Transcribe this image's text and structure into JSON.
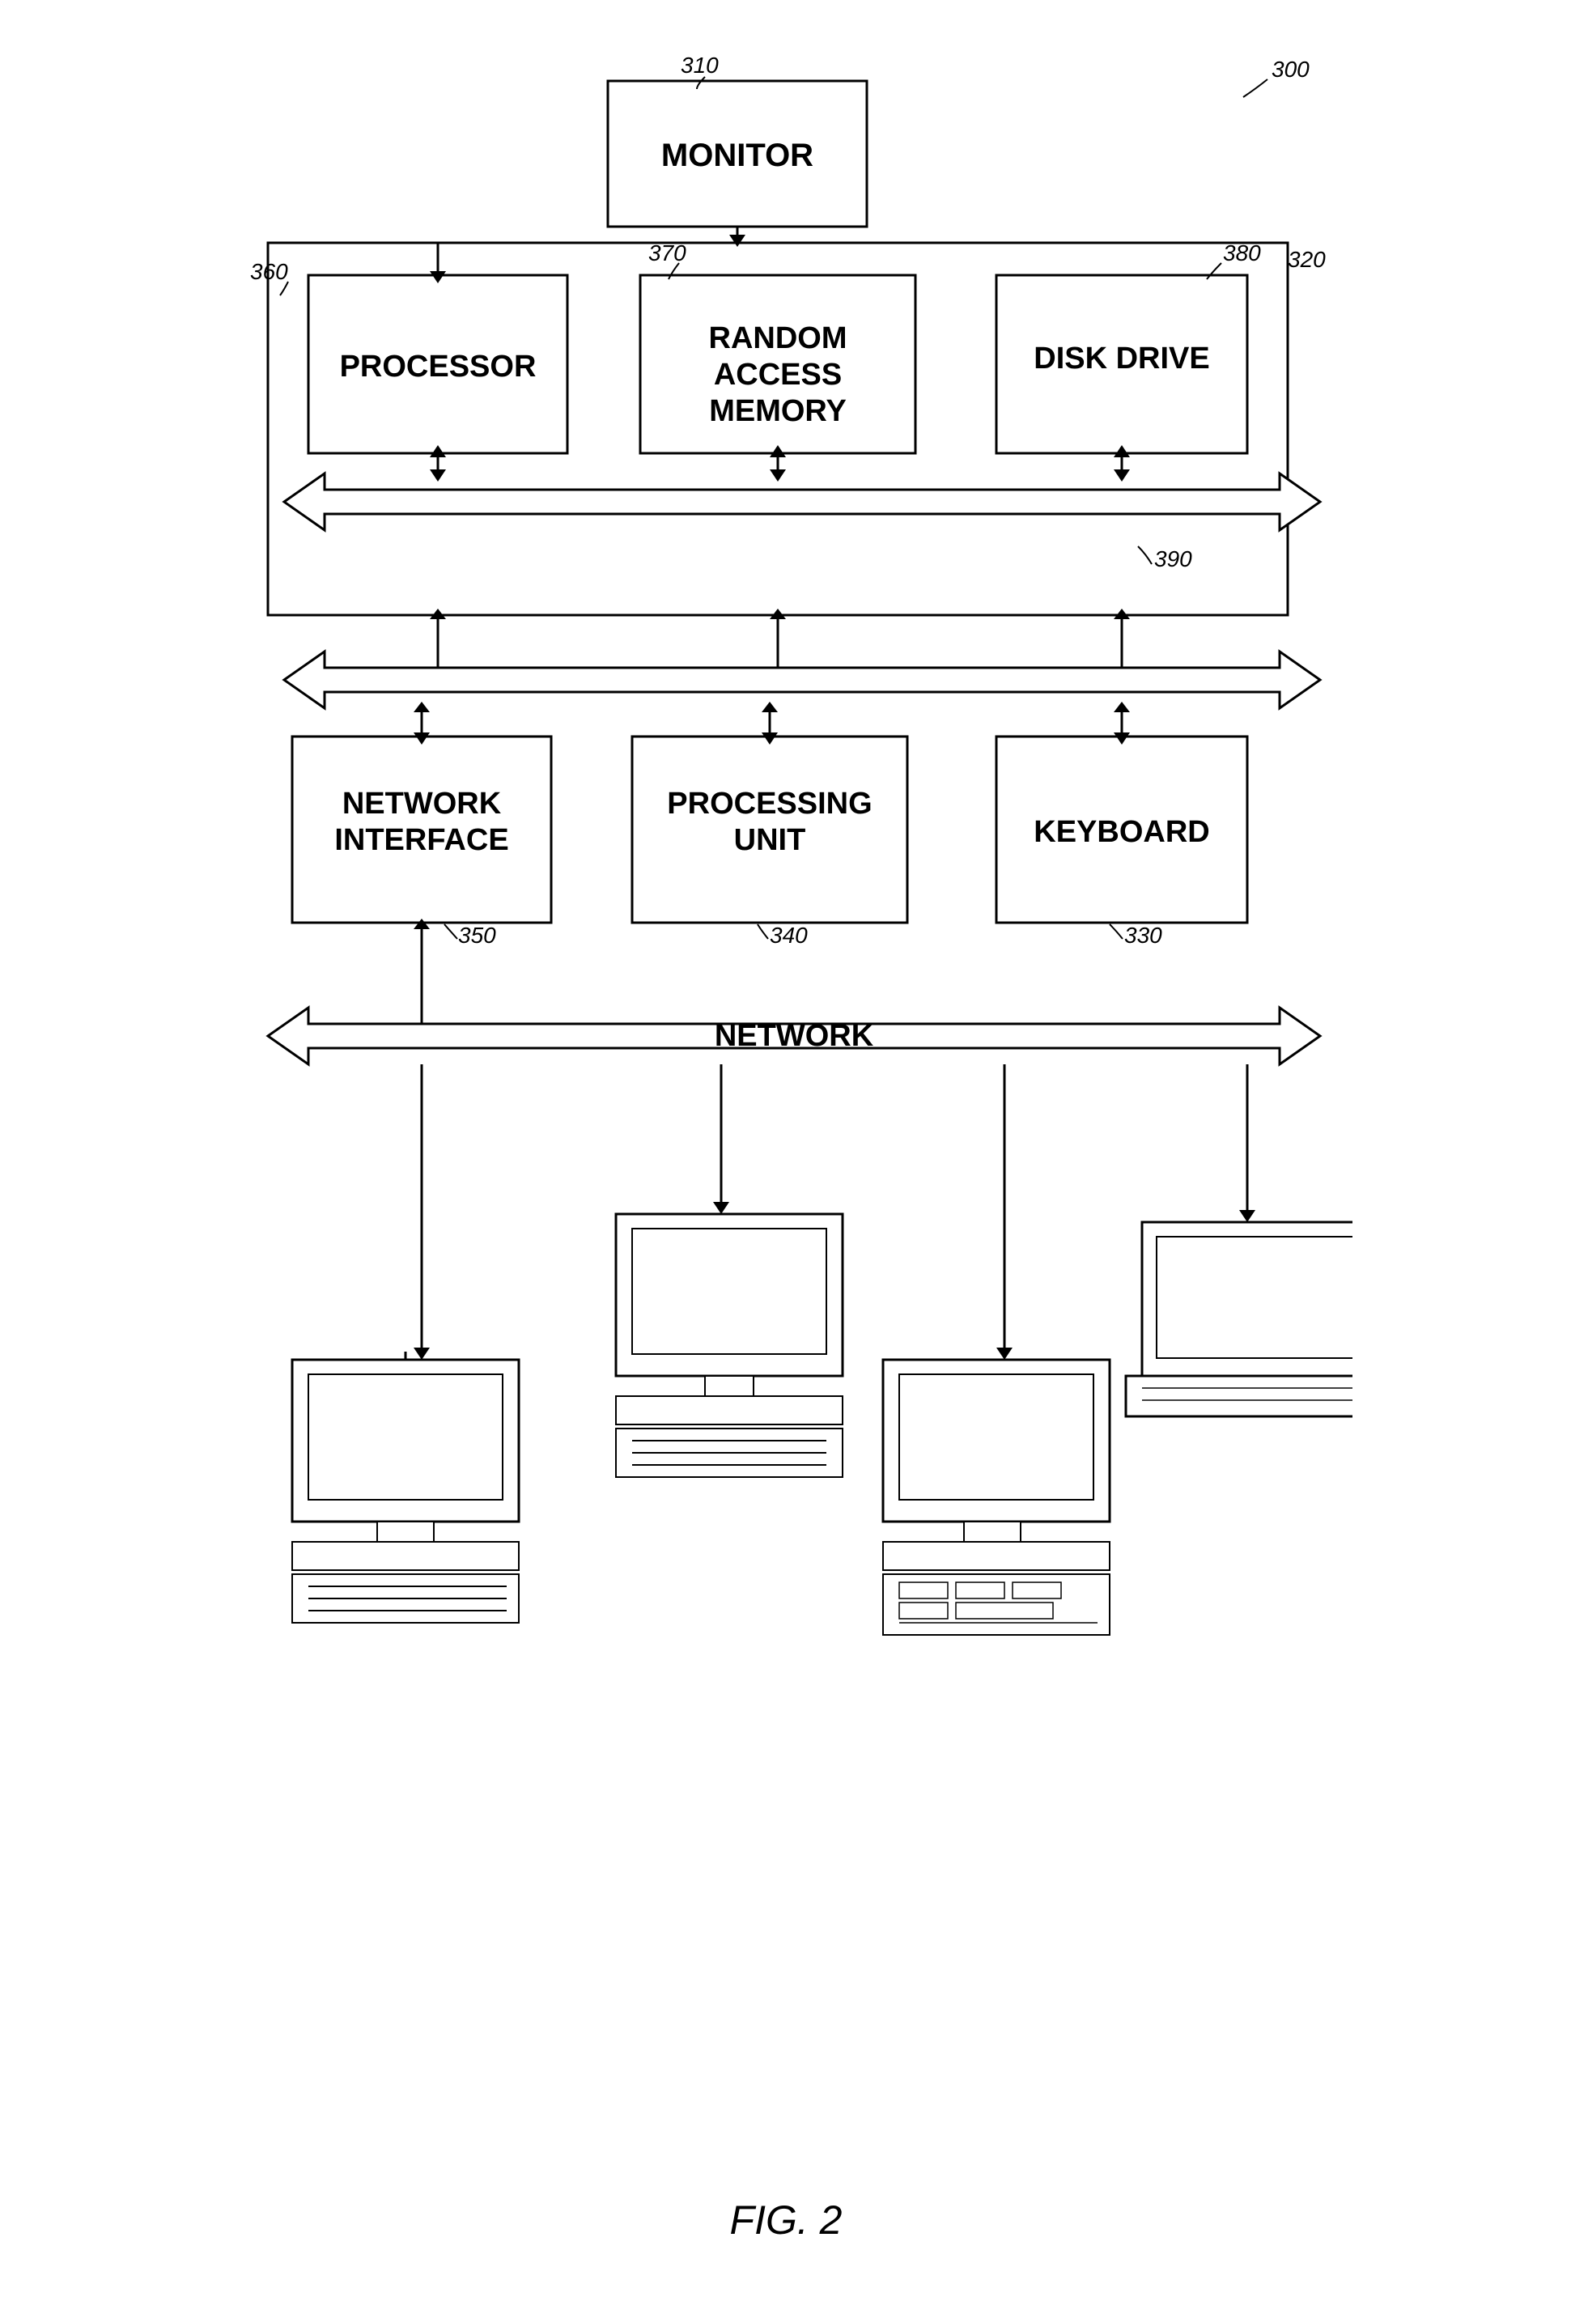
{
  "diagram": {
    "title": "FIG. 2",
    "ref_main": "300",
    "ref_computer_box": "320",
    "ref_monitor": "310",
    "ref_ram": "370",
    "ref_diskdrive": "380",
    "ref_bus390": "390",
    "ref_processor_area": "360",
    "ref_network_interface": "350",
    "ref_processing_unit": "340",
    "ref_keyboard": "330",
    "ref_network_bus": "",
    "components": {
      "monitor": "MONITOR",
      "processor": "PROCESSOR",
      "ram": "RANDOM\nACCESS\nMEMORY",
      "disk_drive": "DISK  DRIVE",
      "network_interface": "NETWORK\nINTERFACE",
      "processing_unit": "PROCESSING\nUNIT",
      "keyboard": "KEYBOARD",
      "network": "NETWORK"
    }
  }
}
